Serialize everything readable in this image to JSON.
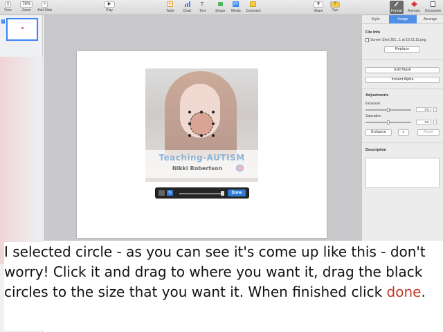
{
  "toolbar": {
    "view": {
      "btn": "▯",
      "label": "View"
    },
    "zoom": {
      "btn": "79%",
      "label": "Zoom"
    },
    "add_slide": {
      "btn": "+",
      "label": "Add Slide"
    },
    "play": {
      "btn": "▶",
      "label": "Play"
    },
    "table": {
      "label": "Table"
    },
    "chart": {
      "label": "Chart"
    },
    "text": {
      "label": "Text"
    },
    "shape": {
      "label": "Shape"
    },
    "media": {
      "label": "Media"
    },
    "comment": {
      "label": "Comment"
    },
    "share": {
      "label": "Share"
    },
    "tips": {
      "label": "Tips"
    },
    "format": {
      "label": "Format"
    },
    "animate": {
      "label": "Animate"
    },
    "document": {
      "label": "Document"
    }
  },
  "navigator": {
    "slide_number": "1"
  },
  "photo": {
    "title": "Teaching-AUTISM",
    "subtitle": "Nikki Robertson"
  },
  "hud": {
    "done_label": "Done"
  },
  "inspector": {
    "tabs": [
      "Style",
      "Image",
      "Arrange"
    ],
    "active_tab": "Image",
    "file_info_heading": "File Info",
    "file_name": "Screen Shot 201...1 at 10.21.15.png",
    "replace_label": "Replace",
    "edit_mask_label": "Edit Mask",
    "instant_alpha_label": "Instant Alpha",
    "adjustments_heading": "Adjustments",
    "exposure_label": "Exposure",
    "exposure_value": "0%",
    "saturation_label": "Saturation",
    "saturation_value": "0%",
    "enhance_label": "Enhance",
    "reset_label": "Reset",
    "description_heading": "Description"
  },
  "caption": {
    "text_before": "I selected circle - as you can see it's come up like this - don't worry! Click it and drag to where you want it, drag the black circles to the size that you want it. When finished click ",
    "done_word": "done",
    "text_after": "."
  },
  "colors": {
    "accent": "#4f8fe6",
    "done_word": "#c0392b"
  }
}
